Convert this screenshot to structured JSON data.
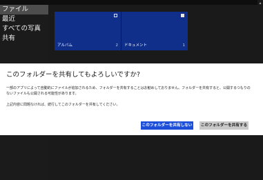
{
  "sidebar": {
    "items": [
      {
        "label": "ファイル",
        "selected": true
      },
      {
        "label": "最近",
        "selected": false
      },
      {
        "label": "すべての写真",
        "selected": false
      },
      {
        "label": "共有",
        "selected": false
      }
    ]
  },
  "tiles": [
    {
      "name": "アルバム",
      "count": "2",
      "checked": false
    },
    {
      "name": "ドキュメント",
      "count": "1",
      "checked": true
    }
  ],
  "dialog": {
    "title": "このフォルダーを共有してもよろしいですか?",
    "body": "一部のアプリによって自動的にファイルが追加されるため、フォルダーを共有することはお勧めしておりません。フォルダーを共有すると、公開するつもりのないファイルも公開される可能性があります。",
    "note": "上記内容に問題なければ、続行してこのフォルダーを共有してください。",
    "primary_button": "このフォルダーを共有しない",
    "secondary_button": "このフォルダーを共有する"
  },
  "colors": {
    "tile": "#0f2f8a",
    "primary_button": "#1e4fd8",
    "secondary_button": "#c9c9c9",
    "sidebar_selected": "#4d4d4d"
  },
  "icons": {
    "scroll_up": "chevron-up-icon",
    "tile_checkbox": "checkbox-icon"
  }
}
